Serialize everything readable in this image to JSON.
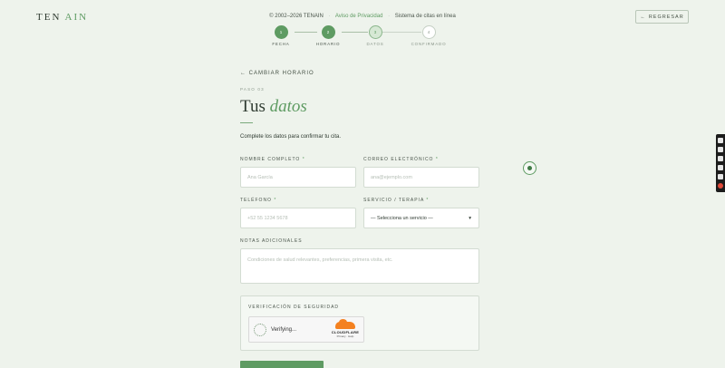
{
  "header": {
    "logo_part1": "TEN ",
    "logo_part2": "AIN",
    "copyright": "© 2002–2026 TENAIN",
    "privacy_link": "Aviso de Privacidad",
    "system_text": "Sistema de citas en línea",
    "back_button_label": "REGRESAR",
    "back_icon": "arrow-left-icon"
  },
  "stepper": {
    "steps": [
      {
        "number": "1",
        "label": "FECHA",
        "state": "done"
      },
      {
        "number": "2",
        "label": "HORARIO",
        "state": "done"
      },
      {
        "number": "3",
        "label": "DATOS",
        "state": "active"
      },
      {
        "number": "4",
        "label": "CONFIRMADO",
        "state": "todo"
      }
    ]
  },
  "form": {
    "change_schedule": "← CAMBIAR HORARIO",
    "step_no": "PASO 03",
    "title_main": "Tus ",
    "title_accent": "datos",
    "intro": "Complete los datos para confirmar tu cita.",
    "required_mark": "*",
    "name": {
      "label": "NOMBRE COMPLETO",
      "placeholder": "Ana García"
    },
    "email": {
      "label": "CORREO ELECTRÓNICO",
      "placeholder": "ana@ejemplo.com"
    },
    "phone": {
      "label": "TELÉFONO",
      "placeholder": "+52 55 1234 5678"
    },
    "service": {
      "label": "SERVICIO / TERAPIA",
      "value": "— Selecciona un servicio —",
      "chevron": "▾"
    },
    "notes": {
      "label": "NOTAS ADICIONALES",
      "placeholder": "Condiciones de salud relevantes, preferencias, primera visita, etc."
    }
  },
  "security": {
    "label": "VERIFICACIÓN DE SEGURIDAD",
    "verifying": "Verifying...",
    "provider": "CLOUDFLARE",
    "provider_links": "Privacy · Help"
  },
  "colors": {
    "accent": "#5e9b62",
    "background": "#eef3ec"
  }
}
